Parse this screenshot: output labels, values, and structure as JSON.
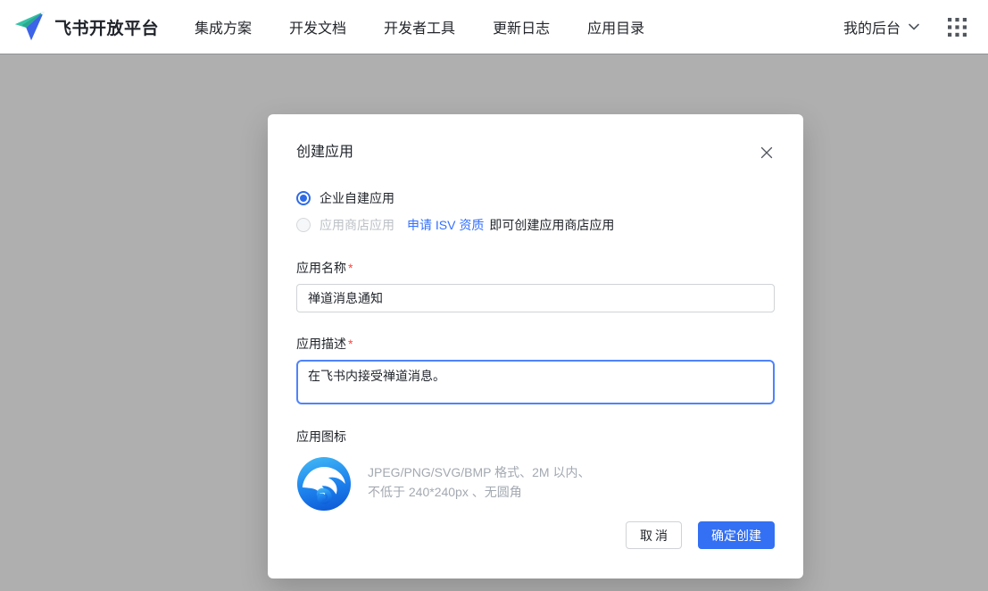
{
  "header": {
    "brand": "飞书开放平台",
    "nav_items": [
      "集成方案",
      "开发文档",
      "开发者工具",
      "更新日志",
      "应用目录"
    ],
    "my_console_label": "我的后台",
    "icons": {
      "logo": "feishu-paper-plane-icon",
      "dropdown": "chevron-down-icon",
      "apps": "grid-9-dots-icon"
    }
  },
  "modal": {
    "title": "创建应用",
    "close_icon": "close-x-icon",
    "radio_options": [
      {
        "label": "企业自建应用",
        "state": "selected"
      },
      {
        "label": "应用商店应用",
        "state": "disabled"
      }
    ],
    "isv_link_text": "申请 ISV 资质",
    "isv_suffix_text": "即可创建应用商店应用",
    "name_field": {
      "label": "应用名称",
      "required_mark": "*",
      "value": "禅道消息通知"
    },
    "desc_field": {
      "label": "应用描述",
      "required_mark": "*",
      "value": "在飞书内接受禅道消息。"
    },
    "icon_field": {
      "label": "应用图标",
      "icon_name": "zentao-app-logo",
      "hint_line1": "JPEG/PNG/SVG/BMP 格式、2M 以内、",
      "hint_line2": "不低于 240*240px 、无圆角"
    },
    "cancel_label": "取消",
    "confirm_label": "确定创建"
  },
  "colors": {
    "accent_blue": "#3370ff",
    "confirm_button_blue": "#3370f4",
    "focus_border_blue": "#4e83fd",
    "required_red": "#f54a45",
    "overlay_gray": "#afafaf",
    "disabled_text": "#bcc0c6",
    "hint_text": "#a3a9b1"
  }
}
